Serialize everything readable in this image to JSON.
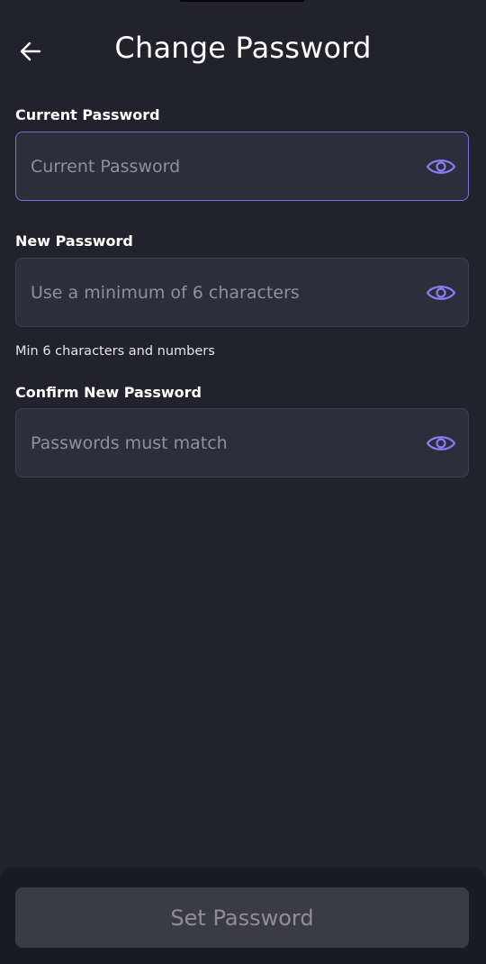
{
  "header": {
    "title": "Change Password",
    "back_icon": "arrow-left-icon"
  },
  "form": {
    "current": {
      "label": "Current Password",
      "placeholder": "Current Password",
      "value": "",
      "toggle_icon": "eye-icon"
    },
    "new": {
      "label": "New Password",
      "placeholder": "Use a minimum of 6 characters",
      "value": "",
      "hint": "Min 6 characters and numbers",
      "toggle_icon": "eye-icon"
    },
    "confirm": {
      "label": "Confirm New Password",
      "placeholder": "Passwords must match",
      "value": "",
      "toggle_icon": "eye-icon"
    }
  },
  "footer": {
    "submit_label": "Set Password"
  },
  "colors": {
    "background": "#22222d",
    "field_bg": "#2d2d3b",
    "accent": "#7b6fe0",
    "button_disabled": "#3b3b43"
  }
}
